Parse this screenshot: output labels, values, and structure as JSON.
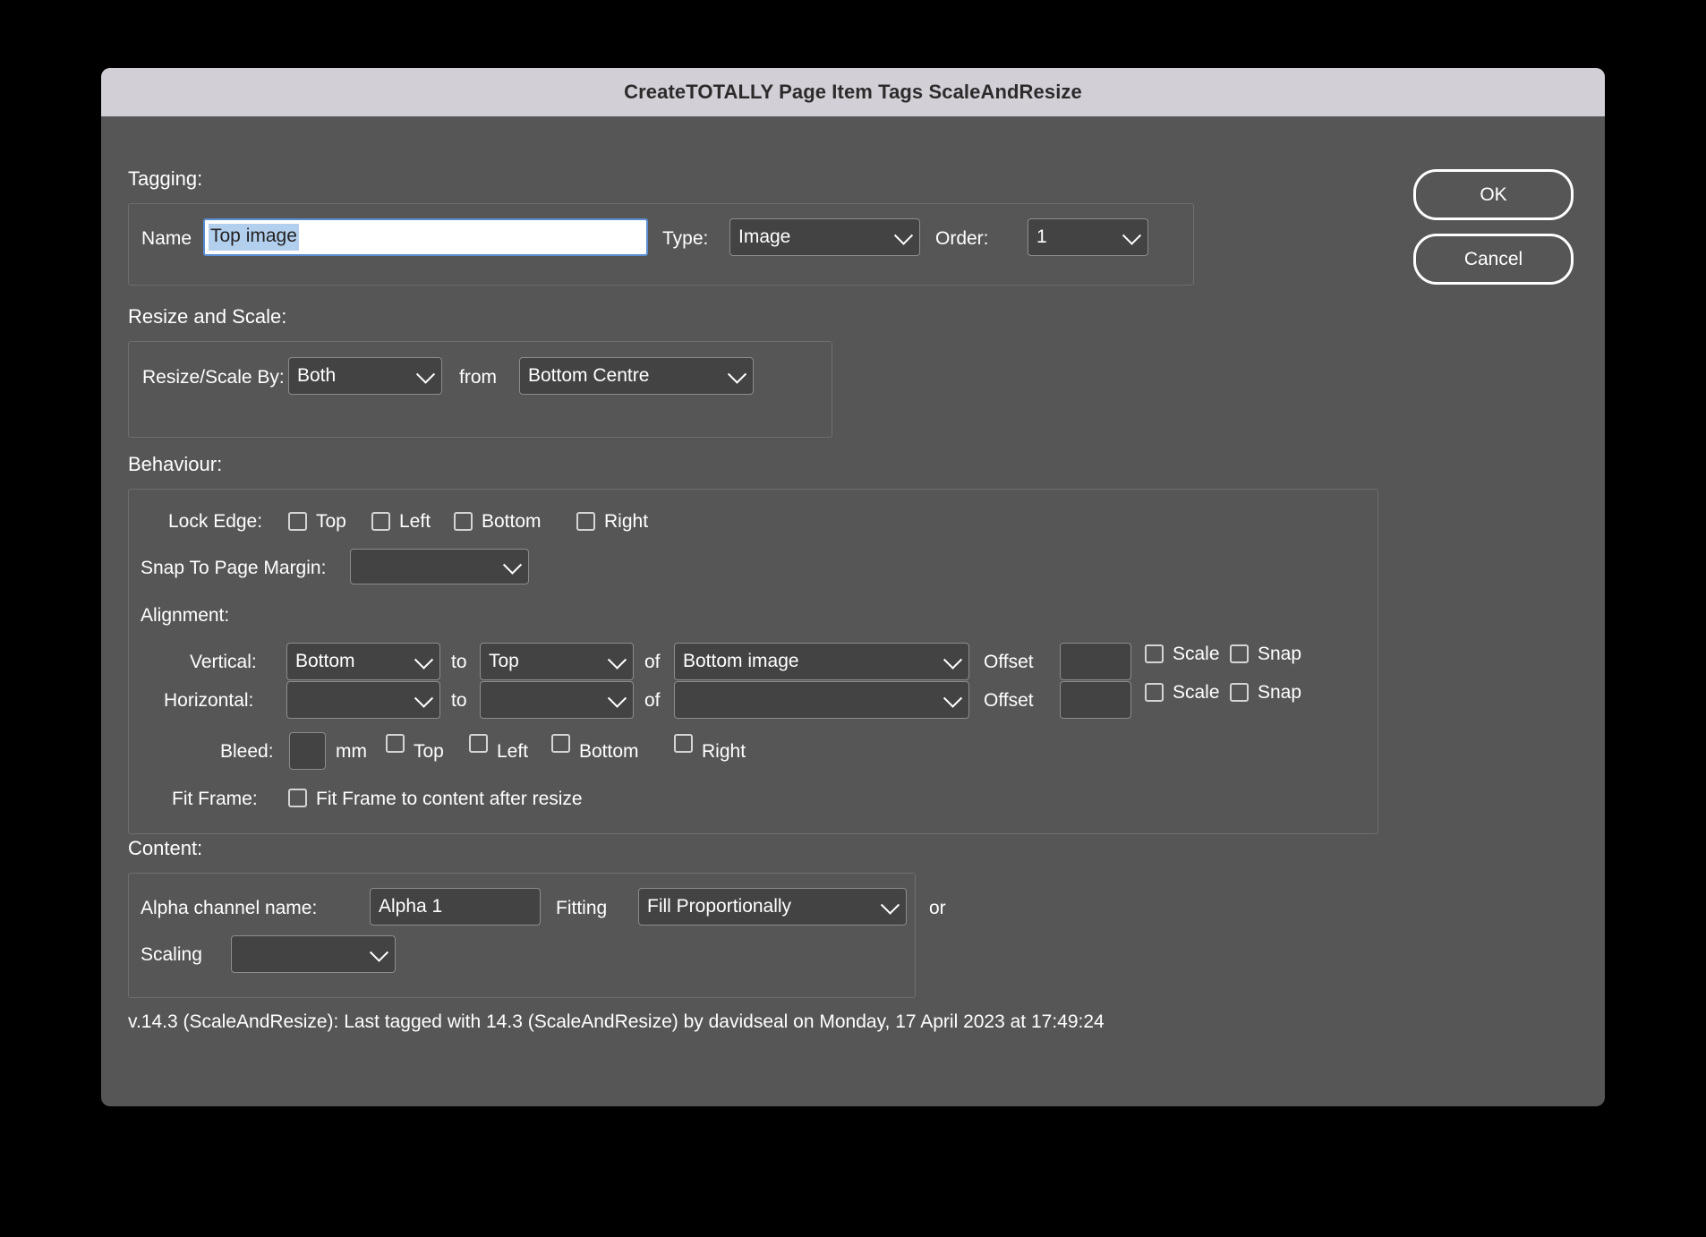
{
  "window": {
    "title": "CreateTOTALLY Page Item Tags ScaleAndResize"
  },
  "buttons": {
    "ok": "OK",
    "cancel": "Cancel"
  },
  "tagging": {
    "heading": "Tagging:",
    "name_label": "Name",
    "name_value": "Top image",
    "name_selected": true,
    "type_label": "Type:",
    "type_value": "Image",
    "order_label": "Order:",
    "order_value": "1"
  },
  "resize_and_scale": {
    "heading": "Resize and Scale:",
    "by_label": "Resize/Scale By:",
    "by_value": "Both",
    "from_label": "from",
    "from_value": "Bottom Centre"
  },
  "behaviour": {
    "heading": "Behaviour:",
    "lock_edge_label": "Lock Edge:",
    "lock_edges": [
      {
        "label": "Top",
        "checked": false
      },
      {
        "label": "Left",
        "checked": false
      },
      {
        "label": "Bottom",
        "checked": false
      },
      {
        "label": "Right",
        "checked": false
      }
    ],
    "snap_margin_label": "Snap To Page Margin:",
    "snap_margin_value": "",
    "alignment_label": "Alignment:",
    "alignment_rows": [
      {
        "axis_label": "Vertical:",
        "from_value": "Bottom",
        "to_label": "to",
        "to_value": "Top",
        "of_label": "of",
        "of_value": "Bottom image",
        "offset_label": "Offset",
        "offset_value": "",
        "scale_label": "Scale",
        "scale_checked": false,
        "snap_label": "Snap",
        "snap_checked": false
      },
      {
        "axis_label": "Horizontal:",
        "from_value": "",
        "to_label": "to",
        "to_value": "",
        "of_label": "of",
        "of_value": "",
        "offset_label": "Offset",
        "offset_value": "",
        "scale_label": "Scale",
        "scale_checked": false,
        "snap_label": "Snap",
        "snap_checked": false
      }
    ],
    "bleed_label": "Bleed:",
    "bleed_value": "",
    "bleed_unit": "mm",
    "bleed_edges": [
      {
        "label": "Top",
        "checked": false
      },
      {
        "label": "Left",
        "checked": false
      },
      {
        "label": "Bottom",
        "checked": false
      },
      {
        "label": "Right",
        "checked": false
      }
    ],
    "fit_frame_label": "Fit Frame:",
    "fit_frame_text": "Fit Frame to content after resize",
    "fit_frame_checked": false
  },
  "content": {
    "heading": "Content:",
    "alpha_label": "Alpha channel name:",
    "alpha_value": "Alpha 1",
    "fitting_label": "Fitting",
    "fitting_value": "Fill Proportionally",
    "or_label": "or",
    "scaling_label": "Scaling",
    "scaling_value": ""
  },
  "footer": {
    "text": "v.14.3 (ScaleAndResize):  Last tagged with 14.3 (ScaleAndResize) by davidseal  on Monday, 17 April 2023 at 17:49:24"
  },
  "colors": {
    "dialog_bg": "#565656",
    "titlebar_bg": "#d3cfd6",
    "field_bg": "#434343",
    "selection_blue": "#b3cfee",
    "focus_border": "#5b8fd4"
  }
}
